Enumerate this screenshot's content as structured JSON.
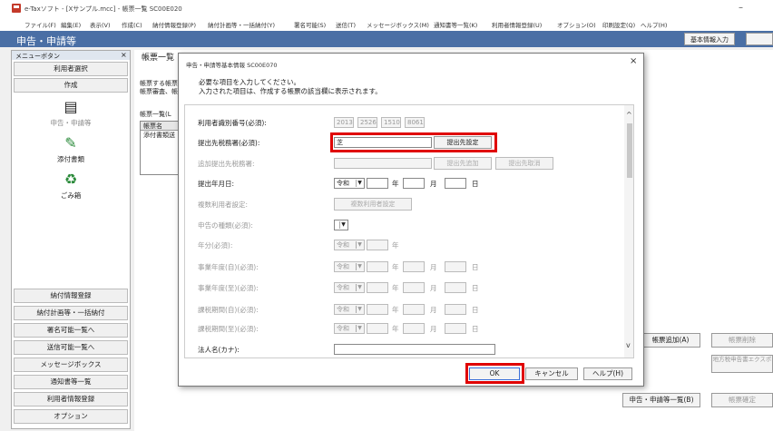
{
  "window": {
    "title": "e-Taxソフト - [Xサンプル.mcc] - 帳票一覧 SC00E020"
  },
  "menubar": {
    "items": [
      "ファイル(F)",
      "編集(E)",
      "表示(V)",
      "作成(C)",
      "納付情報登録(P)",
      "納付計画等・一括納付(Y)",
      "署名可能(S)",
      "送信(T)",
      "メッセージボックス(M)",
      "通知書等一覧(K)",
      "利用者情報登録(U)",
      "オプション(O)",
      "印刷設定(Q)",
      "ヘルプ(H)"
    ]
  },
  "banner": {
    "title": "申告・申請等",
    "basic_info_button": "基本情報入力"
  },
  "sidebar": {
    "header": "メニューボタン",
    "user_select": "利用者選択",
    "create": "作成",
    "icons": [
      {
        "label": "申告・申請等",
        "icon": "document-icon"
      },
      {
        "label": "添付書類",
        "icon": "attachment-icon"
      },
      {
        "label": "ごみ箱",
        "icon": "trash-icon"
      }
    ],
    "bottom_buttons": [
      "納付情報登録",
      "納付計画等・一括納付",
      "署名可能一覧へ",
      "送信可能一覧へ",
      "メッセージボックス",
      "通知書等一覧",
      "利用者情報登録",
      "オプション"
    ]
  },
  "main": {
    "heading": "帳票一覧",
    "desc_line1": "帳票する帳票",
    "desc_line2": "帳票審査、帳",
    "list_label": "帳票一覧(L",
    "list_header": "帳票名",
    "list_row": "添付書類送",
    "add_form_button": "帳票追加(A)",
    "delete_form_button": "帳票削除",
    "local_tax_button": "地方税申告書エクスポ",
    "list_button": "申告・申請等一覧(B)",
    "check_button": "帳票確定"
  },
  "dialog": {
    "title": "申告・申請等基本情報 SC00E070",
    "instruction1": "必要な項目を入力してください。",
    "instruction2": "入力された項目は、作成する帳票の該当欄に表示されます。",
    "fields": {
      "user_id_label": "利用者識別番号(必須):",
      "user_id_parts": [
        "2013",
        "2526",
        "1510",
        "8061"
      ],
      "tax_office_label": "提出先税務署(必須):",
      "tax_office_value": "芝",
      "tax_office_button": "提出先設定",
      "additional_office_label": "追加提出先税務署:",
      "additional_add_button": "提出先追加",
      "additional_remove_button": "提出先取消",
      "submit_date_label": "提出年月日:",
      "era": "令和",
      "year_unit": "年",
      "month_unit": "月",
      "day_unit": "日",
      "multi_user_label": "複数利用者設定:",
      "multi_user_button": "複数利用者設定",
      "filing_type_label": "申告の種類(必須):",
      "year_label": "年分(必須):",
      "fiscal_from_label": "事業年度(自)(必須):",
      "fiscal_to_label": "事業年度(至)(必須):",
      "taxable_from_label": "課税期間(自)(必須):",
      "taxable_to_label": "課税期間(至)(必須):",
      "corp_name_label": "法人名(カナ):"
    },
    "ok_button": "OK",
    "cancel_button": "キャンセル",
    "help_button": "ヘルプ(H)",
    "close_glyph": "×",
    "scroll_up_glyph": "^",
    "scroll_down_glyph": "v"
  },
  "colors": {
    "banner": "#4a6fa5",
    "highlight": "#e00000"
  }
}
